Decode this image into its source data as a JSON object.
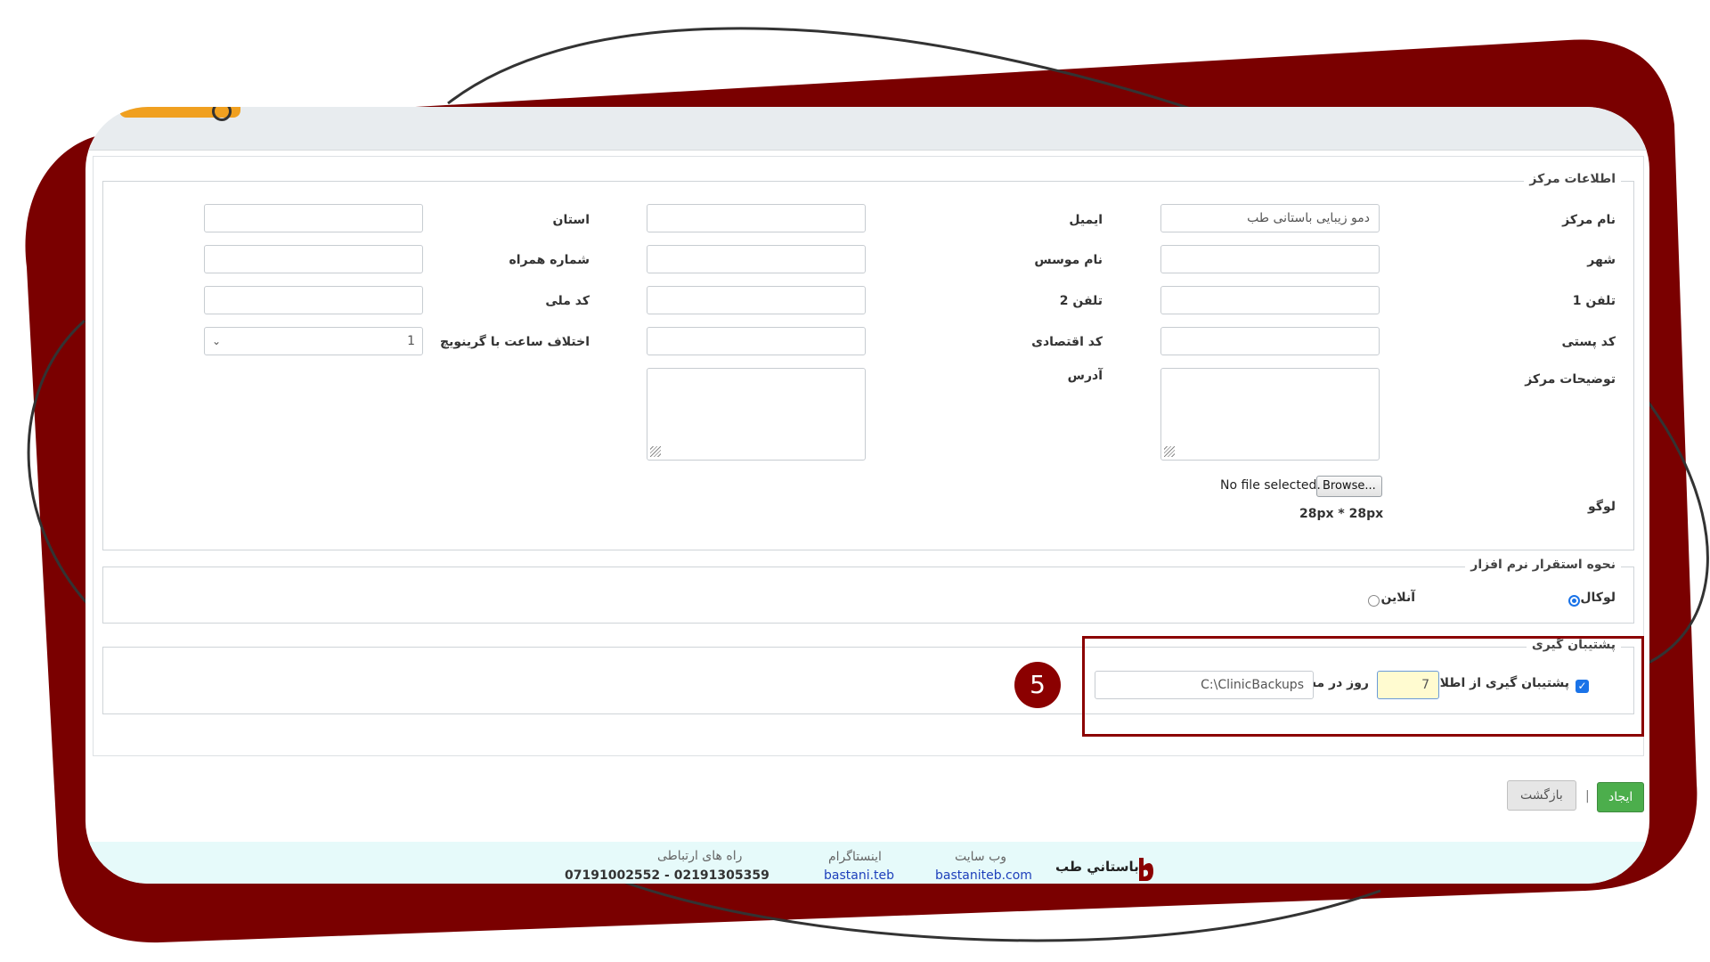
{
  "center_info": {
    "legend": "اطلاعات مرکز",
    "labels": {
      "center_name": "نام مرکز",
      "city": "شهر",
      "phone1": "تلفن 1",
      "postal_code": "کد پستی",
      "description": "توضیحات مرکز",
      "logo": "لوگو",
      "email": "ایمیل",
      "founder_name": "نام موسس",
      "phone2": "تلفن 2",
      "economic_code": "کد اقتصادی",
      "address": "آدرس",
      "province": "استان",
      "mobile": "شماره همراه",
      "national_code": "کد ملی",
      "gmt_offset": "اختلاف ساعت با گرینویچ"
    },
    "values": {
      "center_name": "دمو زیبایی باستانی طب",
      "gmt_offset": "1"
    },
    "browse_label": "Browse...",
    "no_file_text": "No file selected.",
    "logo_size_note": "28px * 28px"
  },
  "deployment": {
    "legend": "نحوه استقرار نرم افزار",
    "options": [
      {
        "label": "لوکال",
        "selected": true
      },
      {
        "label": "آنلاین",
        "selected": false
      }
    ]
  },
  "backup": {
    "legend": "پشتیبان گیری",
    "enabled": true,
    "label_prefix": "پشتیبان گیری از اطلاعات هر",
    "days_value": "7",
    "label_suffix": "روز در مسیر",
    "path_value": "C:\\ClinicBackups",
    "step_number": "5"
  },
  "actions": {
    "create_label": "ایجاد",
    "separator": "|",
    "back_label": "بازگشت"
  },
  "footer": {
    "brand": "باستاني طب",
    "website_label": "وب سایت",
    "website_value": "bastaniteb.com",
    "instagram_label": "اینستاگرام",
    "instagram_value": "bastani.teb",
    "contact_label": "راه های ارتباطی",
    "contact_value": "07191002552 - 02191305359"
  },
  "colors": {
    "frame": "#7a0000",
    "highlight": "#8b0000",
    "accent_blue": "#1a73e8",
    "create_green": "#4cae4c",
    "orange_tab": "#f0a020"
  }
}
